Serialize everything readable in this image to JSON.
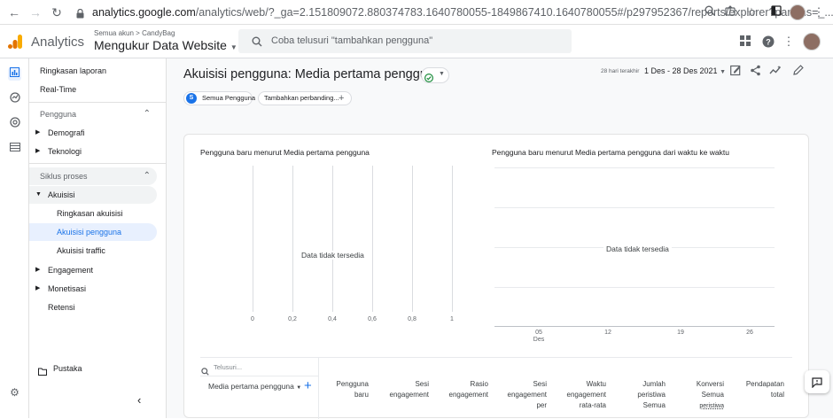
{
  "browser": {
    "url_host": "analytics.google.com",
    "url_path": "/analytics/web/?_ga=2.151809072.880374783.1640780055-1849867410.1640780055#/p297952367/reports/explorer?params=_..."
  },
  "header": {
    "brand": "Analytics",
    "breadcrumb_account": "Semua akun",
    "breadcrumb_sep": ">",
    "breadcrumb_property": "CandyBag",
    "property_name": "Mengukur Data Website",
    "search_placeholder": "Coba telusuri \"tambahkan pengguna\""
  },
  "nav": {
    "ringkasan": "Ringkasan laporan",
    "realtime": "Real-Time",
    "section_pengguna": "Pengguna",
    "demografi": "Demografi",
    "teknologi": "Teknologi",
    "section_siklus": "Siklus proses",
    "akuisisi": "Akuisisi",
    "ringkasan_akuisisi": "Ringkasan akuisisi",
    "akuisisi_pengguna": "Akuisisi pengguna",
    "akuisisi_traffic": "Akuisisi traffic",
    "engagement": "Engagement",
    "monetisasi": "Monetisasi",
    "retensi": "Retensi",
    "pustaka": "Pustaka"
  },
  "report": {
    "title": "Akuisisi pengguna: Media pertama pengguna",
    "date_label": "28 hari terakhir",
    "date_range": "1 Des - 28 Des 2021",
    "segment_initial": "S",
    "segment_label": "Semua Pengguna",
    "compare_label": "Tambahkan perbanding..."
  },
  "charts": {
    "bar_title": "Pengguna baru menurut Media pertama pengguna",
    "bar_nodata": "Data tidak tersedia",
    "bar_ticks": [
      "0",
      "0,2",
      "0,4",
      "0,6",
      "0,8",
      "1"
    ],
    "line_title": "Pengguna baru menurut Media pertama pengguna dari waktu ke waktu",
    "line_nodata": "Data tidak tersedia",
    "line_ticks": [
      "05",
      "12",
      "19",
      "26"
    ],
    "line_tick_sub": "Des"
  },
  "table": {
    "search_placeholder": "Telusuri...",
    "dimension": "Media pertama pengguna",
    "columns": [
      {
        "line1": "Pengguna",
        "line2": "baru",
        "line3": ""
      },
      {
        "line1": "Sesi",
        "line2": "engagement",
        "line3": ""
      },
      {
        "line1": "Rasio",
        "line2": "engagement",
        "line3": ""
      },
      {
        "line1": "Sesi",
        "line2": "engagement",
        "line3": "per"
      },
      {
        "line1": "Waktu",
        "line2": "engagement",
        "line3": "rata-rata"
      },
      {
        "line1": "Jumlah",
        "line2": "peristiwa",
        "line3": "Semua"
      },
      {
        "line1": "Konversi",
        "line2": "Semua",
        "line3": "peristiwa"
      },
      {
        "line1": "Pendapatan",
        "line2": "total",
        "line3": ""
      }
    ]
  },
  "colors": {
    "accent": "#1a73e8",
    "ga_orange": "#f9ab00",
    "ga_dark_orange": "#e37400",
    "success": "#1e8e3e"
  }
}
